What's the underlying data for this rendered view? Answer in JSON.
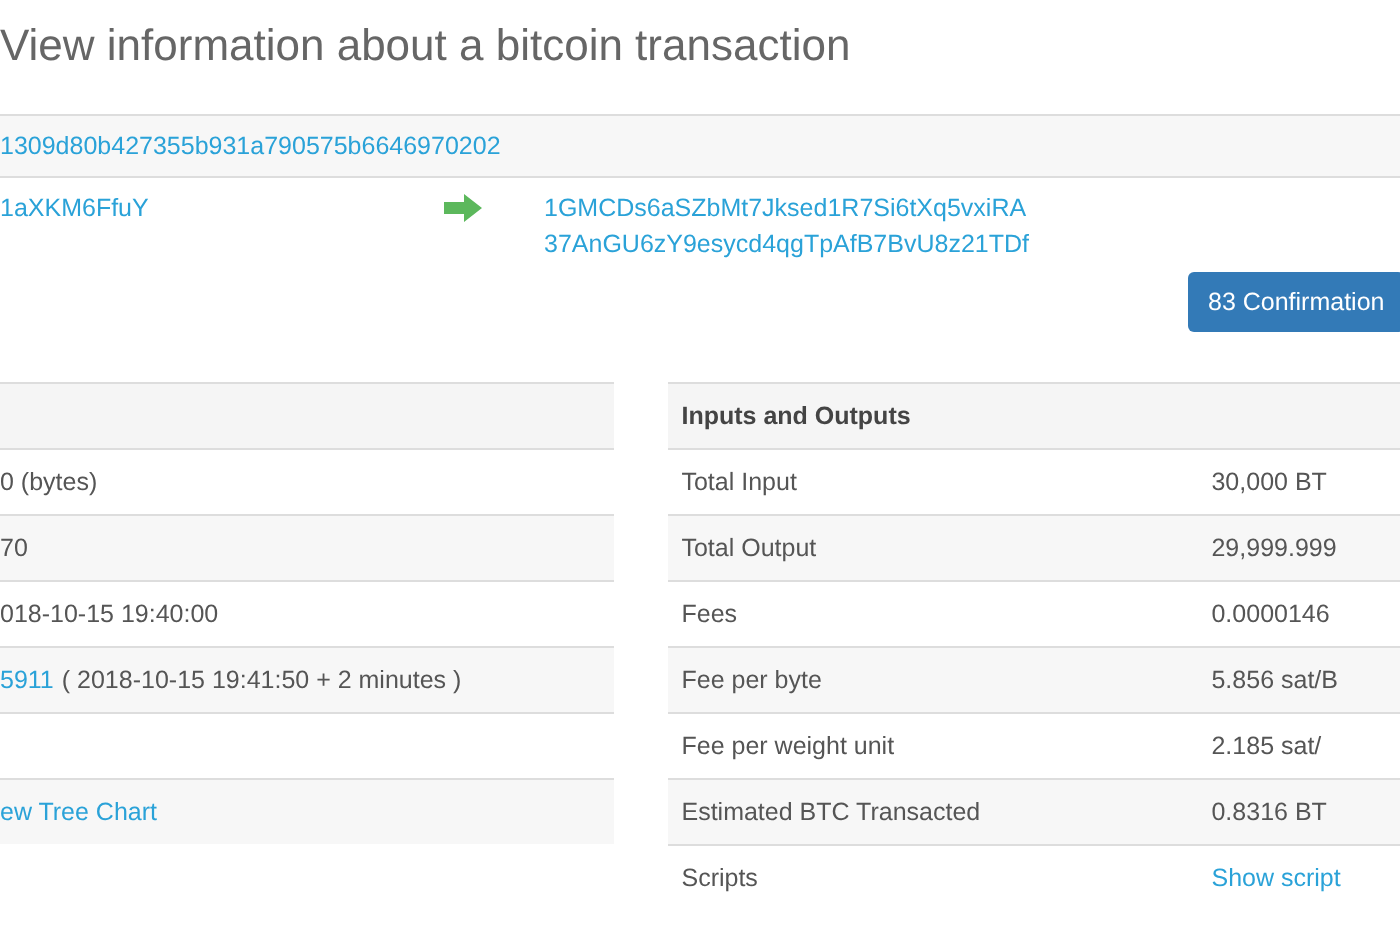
{
  "title": "View information about a bitcoin transaction",
  "transaction": {
    "hash": "1309d80b427355b931a790575b6646970202",
    "input_address": "1aXKM6FfuY",
    "output_addresses": [
      "1GMCDs6aSZbMt7Jksed1R7Si6tXq5vxiRA",
      "37AnGU6zY9esycd4qgTpAfB7BvU8z21TDf"
    ],
    "confirmations": "83 Confirmation"
  },
  "summary": {
    "rows": [
      {
        "value": "0 (bytes)",
        "kind": "text"
      },
      {
        "value": "70",
        "kind": "text"
      },
      {
        "value": "018-10-15 19:40:00",
        "kind": "text"
      },
      {
        "value": "5911",
        "suffix": "( 2018-10-15 19:41:50 + 2 minutes )",
        "kind": "link"
      },
      {
        "kind": "empty"
      },
      {
        "value": "ew Tree Chart",
        "kind": "link"
      }
    ]
  },
  "inputs_outputs": {
    "heading": "Inputs and Outputs",
    "rows": [
      {
        "label": "Total Input",
        "value": "30,000 BT",
        "kind": "text"
      },
      {
        "label": "Total Output",
        "value": "29,999.999",
        "kind": "text"
      },
      {
        "label": "Fees",
        "value": "0.0000146",
        "kind": "text"
      },
      {
        "label": "Fee per byte",
        "value": "5.856 sat/B",
        "kind": "text"
      },
      {
        "label": "Fee per weight unit",
        "value": "2.185 sat/",
        "kind": "text"
      },
      {
        "label": "Estimated BTC Transacted",
        "value": "0.8316 BT",
        "kind": "text"
      },
      {
        "label": "Scripts",
        "value": "Show script",
        "kind": "link"
      }
    ]
  }
}
